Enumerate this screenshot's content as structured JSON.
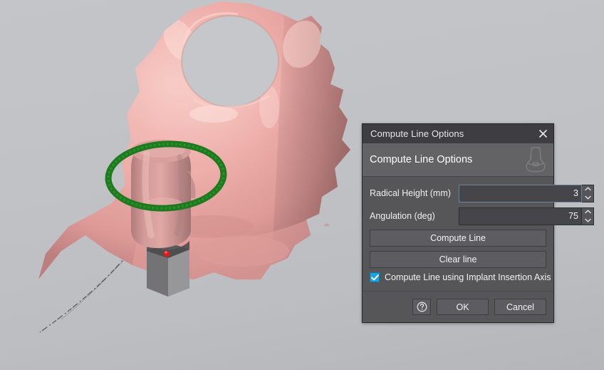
{
  "viewport": {
    "name": "3d-model-viewport",
    "background_top": "#c3c5c8",
    "background_bottom": "#b4b6ba",
    "objects": [
      {
        "name": "bone-mesh",
        "color": "#e9a8a4",
        "description": "pink jaw bone / gingiva mesh with circular opening"
      },
      {
        "name": "abutment",
        "color": "#c98c8c",
        "description": "pink cylindrical abutment"
      },
      {
        "name": "implant",
        "color": "#8e8e91",
        "description": "gray hexagonal implant body"
      },
      {
        "name": "selection-ellipse",
        "color": "#1f7a1f",
        "description": "green elliptical selection ring"
      },
      {
        "name": "marker-point",
        "color": "#e11b1b",
        "description": "red marker point"
      }
    ]
  },
  "dialog": {
    "title": "Compute Line Options",
    "close_label": "×",
    "header_title": "Compute Line Options",
    "header_icon": "abutment-icon",
    "fields": [
      {
        "label": "Radical Height (mm)",
        "value": "3",
        "focused": true
      },
      {
        "label": "Angulation (deg)",
        "value": "75",
        "focused": false
      }
    ],
    "actions": [
      {
        "label": "Compute Line",
        "name": "compute-line-button"
      },
      {
        "label": "Clear line",
        "name": "clear-line-button"
      }
    ],
    "checkbox": {
      "label": "Compute Line using Implant Insertion Axis",
      "checked": true,
      "color": "#1ea2dd"
    },
    "footer": {
      "help_label": "?",
      "ok_label": "OK",
      "cancel_label": "Cancel"
    }
  }
}
